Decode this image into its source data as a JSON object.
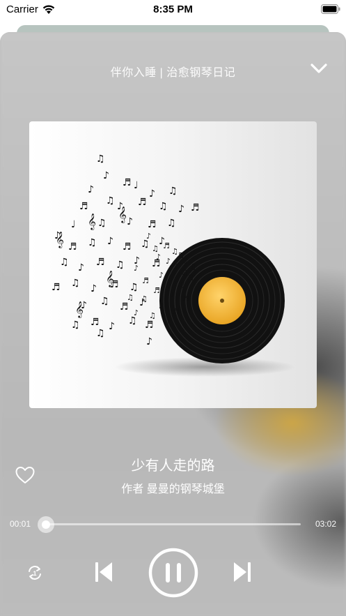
{
  "status_bar": {
    "carrier": "Carrier",
    "time": "8:35 PM"
  },
  "player": {
    "playlist_title": "伴你入睡 | 治愈钢琴日记",
    "track": {
      "title": "少有人走的路",
      "artist": "作者 曼曼的钢琴城堡"
    },
    "progress": {
      "current_time": "00:01",
      "total_time": "03:02",
      "fraction": 0.006
    },
    "colors": {
      "record_label": "#f0b233",
      "accent": "#ffffff"
    },
    "icons": {
      "collapse": "chevron-down-icon",
      "favorite": "heart-icon",
      "repeat": "repeat-one-icon",
      "previous": "skip-previous-icon",
      "play_pause": "pause-icon",
      "next": "skip-next-icon"
    }
  }
}
